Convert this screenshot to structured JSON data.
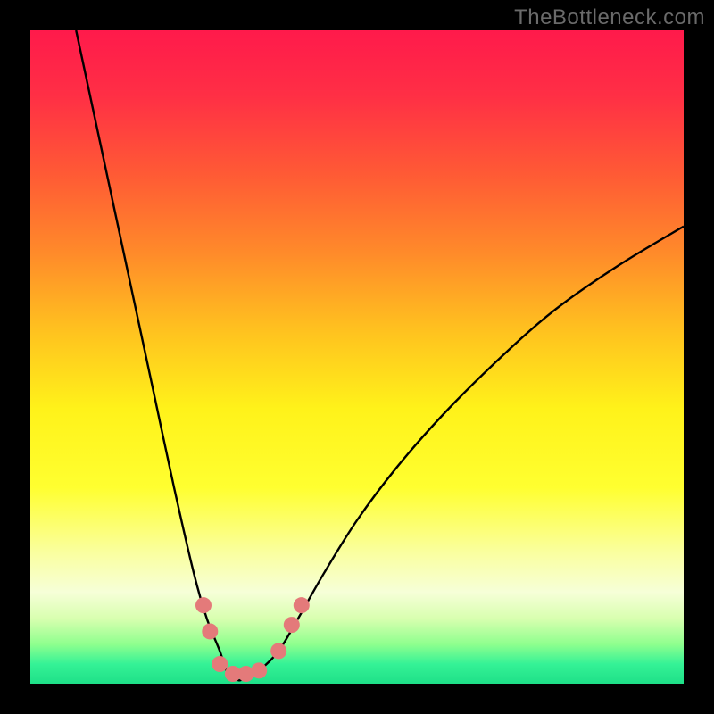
{
  "watermark": "TheBottleneck.com",
  "chart_data": {
    "type": "line",
    "title": "",
    "xlabel": "",
    "ylabel": "",
    "xlim": [
      0,
      100
    ],
    "ylim": [
      0,
      100
    ],
    "gradient_stops": [
      {
        "pos": 0.0,
        "color": "#ff1a4b"
      },
      {
        "pos": 0.1,
        "color": "#ff2f45"
      },
      {
        "pos": 0.22,
        "color": "#ff5a35"
      },
      {
        "pos": 0.34,
        "color": "#ff8a2a"
      },
      {
        "pos": 0.46,
        "color": "#ffc21f"
      },
      {
        "pos": 0.58,
        "color": "#fff21a"
      },
      {
        "pos": 0.7,
        "color": "#ffff30"
      },
      {
        "pos": 0.8,
        "color": "#faffa0"
      },
      {
        "pos": 0.86,
        "color": "#f6ffd8"
      },
      {
        "pos": 0.9,
        "color": "#d9ffb0"
      },
      {
        "pos": 0.94,
        "color": "#8eff8e"
      },
      {
        "pos": 0.97,
        "color": "#35f296"
      },
      {
        "pos": 1.0,
        "color": "#1ee088"
      }
    ],
    "series": [
      {
        "name": "bottleneck-curve",
        "color": "#000000",
        "x": [
          7,
          10,
          13,
          16,
          19,
          22,
          25,
          27,
          29,
          30,
          31,
          32,
          33,
          35,
          38,
          41,
          45,
          50,
          56,
          63,
          71,
          80,
          90,
          100
        ],
        "y": [
          100,
          86,
          72,
          58,
          44,
          30,
          17,
          10,
          5,
          2,
          1,
          0.5,
          1,
          2,
          5,
          10,
          17,
          25,
          33,
          41,
          49,
          57,
          64,
          70
        ]
      }
    ],
    "markers": {
      "name": "bottom-markers",
      "color": "#e47a7a",
      "points": [
        {
          "x": 26.5,
          "y": 12
        },
        {
          "x": 27.5,
          "y": 8
        },
        {
          "x": 29.0,
          "y": 3
        },
        {
          "x": 31.0,
          "y": 1.5
        },
        {
          "x": 33.0,
          "y": 1.5
        },
        {
          "x": 35.0,
          "y": 2
        },
        {
          "x": 38.0,
          "y": 5
        },
        {
          "x": 40.0,
          "y": 9
        },
        {
          "x": 41.5,
          "y": 12
        }
      ]
    }
  }
}
